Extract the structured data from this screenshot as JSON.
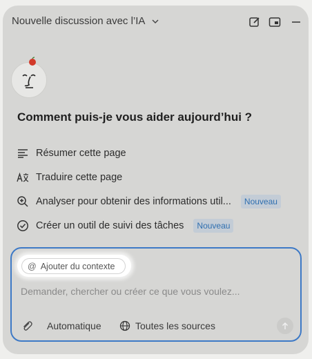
{
  "header": {
    "title": "Nouvelle discussion avec l’IA",
    "icons": [
      "chevron-down-icon",
      "edit-icon",
      "picture-in-picture-icon",
      "minimize-icon"
    ]
  },
  "headline": "Comment puis-je vous aider aujourd’hui ?",
  "actions": [
    {
      "label": "Résumer cette page",
      "icon": "summary-lines-icon"
    },
    {
      "label": "Traduire cette page",
      "icon": "translate-icon"
    },
    {
      "label": "Analyser pour obtenir des informations util...",
      "icon": "zoom-in-icon",
      "badge": "Nouveau"
    },
    {
      "label": "Créer un outil de suivi des tâches",
      "icon": "check-circle-icon",
      "badge": "Nouveau"
    }
  ],
  "composer": {
    "context_label": "Ajouter du contexte",
    "context_symbol": "@",
    "placeholder": "Demander, chercher ou créer ce que vous voulez...",
    "mode_label": "Automatique",
    "sources_label": "Toutes les sources"
  },
  "colors": {
    "accent": "#3d79c6",
    "badge_text": "#2f6fb0",
    "badge_bg": "#c3ccd6",
    "apple": "#d23a2a"
  }
}
